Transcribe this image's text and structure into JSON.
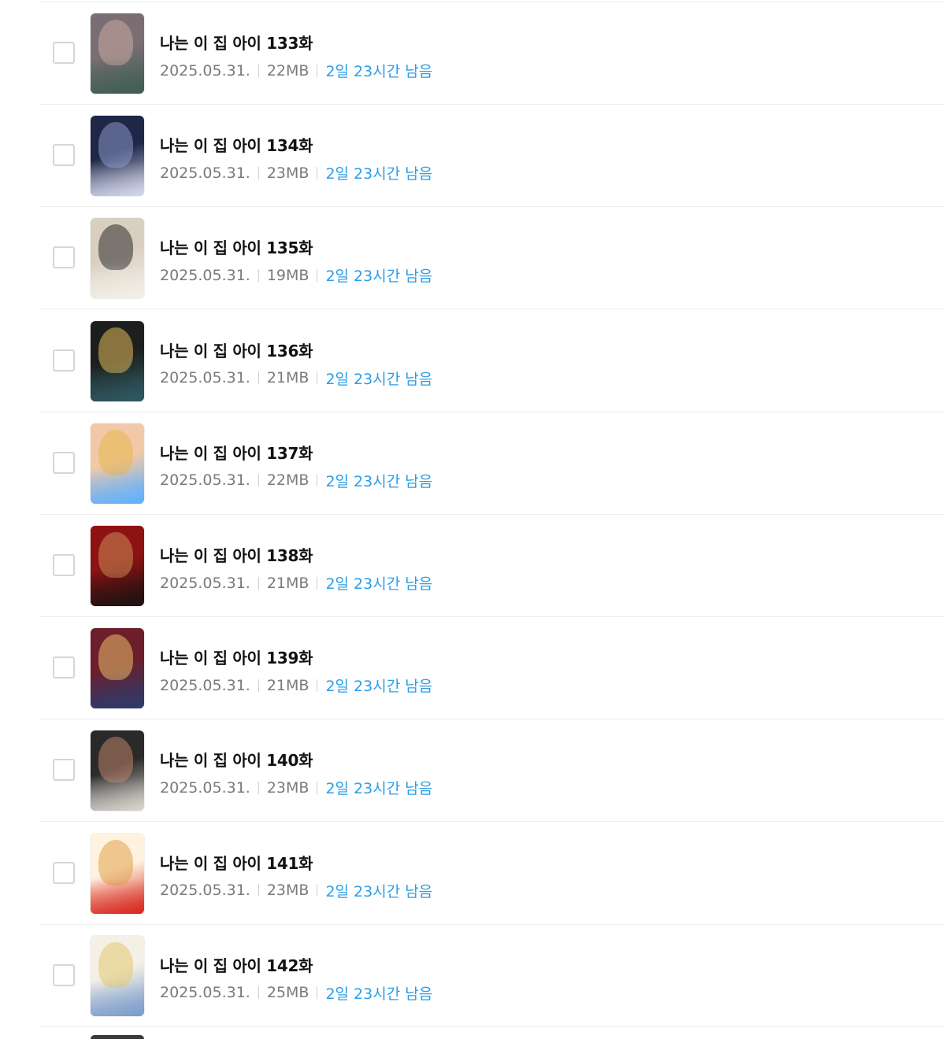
{
  "episodes": [
    {
      "title": "나는 이 집 아이 133화",
      "date": "2025.05.31.",
      "size": "22MB",
      "remaining": "2일 23시간 남음",
      "thumb_colors": [
        "#7a6e74",
        "#c9a9a0",
        "#3f5f52"
      ]
    },
    {
      "title": "나는 이 집 아이 134화",
      "date": "2025.05.31.",
      "size": "23MB",
      "remaining": "2일 23시간 남음",
      "thumb_colors": [
        "#1f2747",
        "#8b97c8",
        "#d5d9ee"
      ]
    },
    {
      "title": "나는 이 집 아이 135화",
      "date": "2025.05.31.",
      "size": "19MB",
      "remaining": "2일 23시간 남음",
      "thumb_colors": [
        "#d9cfc0",
        "#2b2b2b",
        "#f3efe8"
      ]
    },
    {
      "title": "나는 이 집 아이 136화",
      "date": "2025.05.31.",
      "size": "21MB",
      "remaining": "2일 23시간 남음",
      "thumb_colors": [
        "#1d1f1e",
        "#e2b85a",
        "#2f5a62"
      ]
    },
    {
      "title": "나는 이 집 아이 137화",
      "date": "2025.05.31.",
      "size": "22MB",
      "remaining": "2일 23시간 남음",
      "thumb_colors": [
        "#f2c9a8",
        "#e7b64f",
        "#5fb0ff"
      ]
    },
    {
      "title": "나는 이 집 아이 138화",
      "date": "2025.05.31.",
      "size": "21MB",
      "remaining": "2일 23시간 남음",
      "thumb_colors": [
        "#8e1212",
        "#c78a5a",
        "#1c1210"
      ]
    },
    {
      "title": "나는 이 집 아이 139화",
      "date": "2025.05.31.",
      "size": "21MB",
      "remaining": "2일 23시간 남음",
      "thumb_colors": [
        "#6d1e2a",
        "#e8c06a",
        "#2e3a6a"
      ]
    },
    {
      "title": "나는 이 집 아이 140화",
      "date": "2025.05.31.",
      "size": "23MB",
      "remaining": "2일 23시간 남음",
      "thumb_colors": [
        "#2b2a2a",
        "#b9826a",
        "#d9d6cf"
      ]
    },
    {
      "title": "나는 이 집 아이 141화",
      "date": "2025.05.31.",
      "size": "23MB",
      "remaining": "2일 23시간 남음",
      "thumb_colors": [
        "#fff3df",
        "#e0a14a",
        "#d8261e"
      ]
    },
    {
      "title": "나는 이 집 아이 142화",
      "date": "2025.05.31.",
      "size": "25MB",
      "remaining": "2일 23시간 남음",
      "thumb_colors": [
        "#f4f0e6",
        "#e3c96f",
        "#7a9ccc"
      ]
    }
  ]
}
